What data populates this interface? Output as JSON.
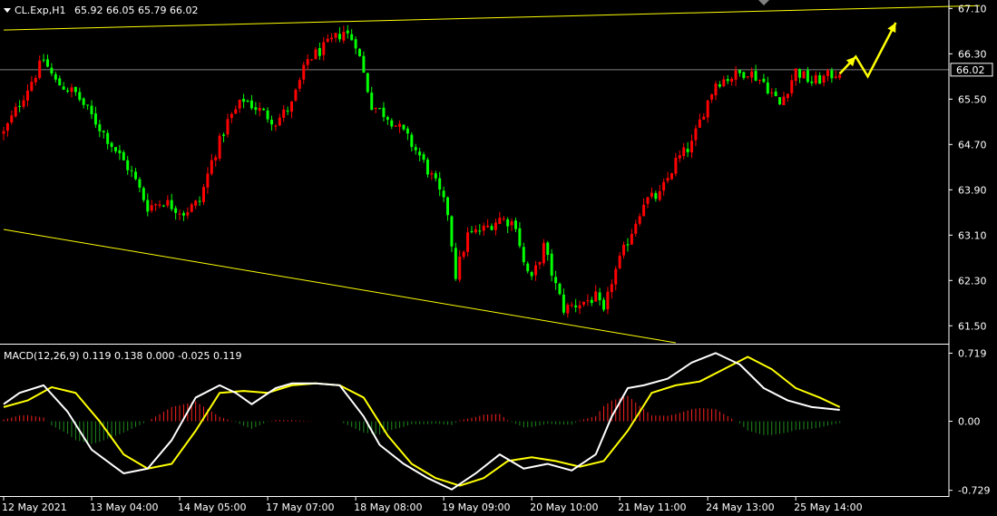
{
  "header": {
    "symbol": "CL.Exp,H1",
    "ohlc": "65.92 66.05 65.79 66.02"
  },
  "colors": {
    "background": "#000000",
    "bull": "#ff0000",
    "bear": "#00ff00",
    "trendline": "#ffff00",
    "macd_line": "#ffffff",
    "signal_line": "#ffff00",
    "hist_pos": "#ff2020",
    "hist_neg": "#1f8a1f",
    "grid": "#808080",
    "current_price_box": "#ffffff"
  },
  "chart_data": [
    {
      "type": "candlestick",
      "title": "CL.Exp,H1",
      "ylim": [
        61.2,
        67.25
      ],
      "y_ticks": [
        "67.10",
        "66.30",
        "65.50",
        "64.70",
        "63.90",
        "63.10",
        "62.30",
        "61.50"
      ],
      "current_price": "66.02",
      "x_ticks": [
        "12 May 2021",
        "13 May 04:00",
        "14 May 05:00",
        "17 May 07:00",
        "18 May 08:00",
        "19 May 09:00",
        "20 May 10:00",
        "21 May 11:00",
        "24 May 13:00",
        "25 May 14:00"
      ],
      "close_anchors": [
        [
          0,
          64.9
        ],
        [
          6,
          65.7
        ],
        [
          10,
          66.2
        ],
        [
          13,
          65.8
        ],
        [
          18,
          65.6
        ],
        [
          22,
          65.2
        ],
        [
          27,
          64.7
        ],
        [
          32,
          64.2
        ],
        [
          36,
          63.6
        ],
        [
          40,
          63.7
        ],
        [
          45,
          63.5
        ],
        [
          49,
          63.7
        ],
        [
          52,
          64.4
        ],
        [
          56,
          65.1
        ],
        [
          60,
          65.5
        ],
        [
          64,
          65.3
        ],
        [
          68,
          65.1
        ],
        [
          72,
          65.4
        ],
        [
          76,
          66.2
        ],
        [
          80,
          66.4
        ],
        [
          85,
          66.7
        ],
        [
          88,
          66.5
        ],
        [
          92,
          65.4
        ],
        [
          96,
          65.2
        ],
        [
          100,
          64.9
        ],
        [
          104,
          64.5
        ],
        [
          108,
          64.0
        ],
        [
          111,
          63.5
        ],
        [
          113,
          62.4
        ],
        [
          116,
          63.1
        ],
        [
          120,
          63.2
        ],
        [
          124,
          63.4
        ],
        [
          128,
          63.3
        ],
        [
          130,
          62.6
        ],
        [
          132,
          62.3
        ],
        [
          135,
          62.9
        ],
        [
          138,
          62.2
        ],
        [
          140,
          61.8
        ],
        [
          144,
          61.9
        ],
        [
          148,
          62.0
        ],
        [
          150,
          61.7
        ],
        [
          152,
          62.3
        ],
        [
          156,
          63.0
        ],
        [
          160,
          63.7
        ],
        [
          164,
          63.8
        ],
        [
          168,
          64.4
        ],
        [
          172,
          64.7
        ],
        [
          175,
          65.3
        ],
        [
          178,
          65.8
        ],
        [
          182,
          65.9
        ],
        [
          186,
          66.0
        ],
        [
          190,
          65.8
        ],
        [
          194,
          65.4
        ],
        [
          198,
          66.0
        ],
        [
          202,
          65.8
        ],
        [
          206,
          65.9
        ],
        [
          209,
          66.0
        ]
      ],
      "candle_count": 210,
      "trendlines": [
        {
          "from": [
            0,
            66.72
          ],
          "to": [
            244,
            67.15
          ]
        },
        {
          "from": [
            0,
            63.2
          ],
          "to": [
            168,
            61.2
          ]
        }
      ],
      "arrow_points": [
        [
          209,
          65.95
        ],
        [
          213,
          66.25
        ],
        [
          216,
          65.9
        ],
        [
          223,
          66.85
        ]
      ]
    },
    {
      "type": "line",
      "title": "MACD(12,26,9) 0.119 0.138 0.000 -0.025 0.119",
      "ylim": [
        -0.78,
        0.8
      ],
      "y_ticks": [
        "0.719",
        "0.00",
        "-0.729"
      ],
      "series": [
        {
          "role": "macd",
          "x": [
            0,
            4,
            10,
            16,
            22,
            30,
            36,
            42,
            48,
            54,
            58,
            62,
            68,
            72,
            78,
            84,
            90,
            94,
            100,
            106,
            112,
            118,
            124,
            130,
            136,
            142,
            148,
            152,
            156,
            160,
            166,
            172,
            178,
            184,
            190,
            196,
            202,
            209
          ],
          "y": [
            0.18,
            0.3,
            0.38,
            0.1,
            -0.3,
            -0.55,
            -0.5,
            -0.2,
            0.25,
            0.38,
            0.3,
            0.18,
            0.35,
            0.4,
            0.4,
            0.38,
            0.05,
            -0.25,
            -0.45,
            -0.6,
            -0.72,
            -0.55,
            -0.35,
            -0.5,
            -0.45,
            -0.52,
            -0.35,
            0.05,
            0.35,
            0.38,
            0.45,
            0.62,
            0.72,
            0.6,
            0.35,
            0.22,
            0.15,
            0.12
          ]
        },
        {
          "role": "signal",
          "x": [
            0,
            6,
            12,
            18,
            24,
            30,
            36,
            42,
            48,
            54,
            60,
            66,
            72,
            78,
            84,
            90,
            96,
            102,
            108,
            114,
            120,
            126,
            132,
            138,
            144,
            150,
            156,
            162,
            168,
            174,
            180,
            186,
            192,
            198,
            204,
            209
          ],
          "y": [
            0.15,
            0.22,
            0.36,
            0.3,
            0.0,
            -0.35,
            -0.5,
            -0.45,
            -0.1,
            0.3,
            0.32,
            0.3,
            0.38,
            0.4,
            0.38,
            0.25,
            -0.15,
            -0.45,
            -0.6,
            -0.68,
            -0.6,
            -0.42,
            -0.38,
            -0.42,
            -0.48,
            -0.42,
            -0.1,
            0.3,
            0.38,
            0.42,
            0.55,
            0.68,
            0.55,
            0.35,
            0.25,
            0.15
          ]
        }
      ]
    }
  ]
}
